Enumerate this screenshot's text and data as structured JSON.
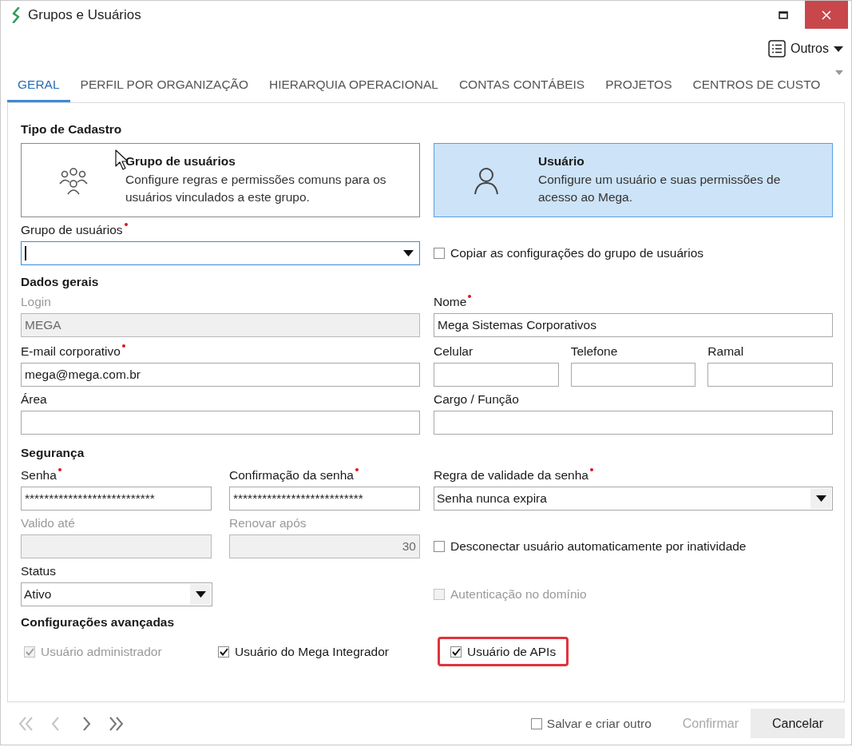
{
  "window": {
    "title": "Grupos e Usuários"
  },
  "toolbar": {
    "menu_label": "Outros"
  },
  "tabs": [
    {
      "label": "GERAL",
      "selected": true
    },
    {
      "label": "PERFIL POR ORGANIZAÇÃO",
      "selected": false
    },
    {
      "label": "HIERARQUIA OPERACIONAL",
      "selected": false
    },
    {
      "label": "CONTAS CONTÁBEIS",
      "selected": false
    },
    {
      "label": "PROJETOS",
      "selected": false
    },
    {
      "label": "CENTROS DE CUSTO",
      "selected": false
    }
  ],
  "registration_type": {
    "title": "Tipo de Cadastro",
    "options": [
      {
        "kind": "group",
        "title": "Grupo de usuários",
        "description": "Configure regras e permissões comuns para os usuários vinculados a este grupo.",
        "selected": false
      },
      {
        "kind": "user",
        "title": "Usuário",
        "description": "Configure um usuário e suas permissões de acesso ao Mega.",
        "selected": true
      }
    ]
  },
  "user_group": {
    "field": {
      "kind": "combo",
      "label": "Grupo de usuários",
      "required": true,
      "disabled": false,
      "focused": true
    },
    "copy_settings": {
      "label": "Copiar as configurações do grupo de usuários",
      "checked": false,
      "disabled": false
    }
  },
  "general_data": {
    "title": "Dados gerais",
    "login": {
      "kind": "text",
      "label": "Login",
      "value": "MEGA",
      "required": false,
      "disabled": true
    },
    "name": {
      "kind": "text",
      "label": "Nome",
      "value": "Mega Sistemas Corporativos",
      "required": true,
      "disabled": false
    },
    "email": {
      "kind": "text",
      "label": "E-mail corporativo",
      "value": "mega@mega.com.br",
      "required": true,
      "disabled": false
    },
    "mobile": {
      "kind": "text",
      "label": "Celular",
      "required": false,
      "disabled": false
    },
    "phone": {
      "kind": "text",
      "label": "Telefone",
      "required": false,
      "disabled": false
    },
    "extension": {
      "kind": "text",
      "label": "Ramal",
      "required": false,
      "disabled": false
    },
    "area": {
      "kind": "text",
      "label": "Área",
      "required": false,
      "disabled": false
    },
    "position": {
      "kind": "text",
      "label": "Cargo / Função",
      "required": false,
      "disabled": false
    }
  },
  "security": {
    "title": "Segurança",
    "password": {
      "kind": "text",
      "label": "Senha",
      "value": "***************************",
      "required": true,
      "disabled": false
    },
    "password_confirmation": {
      "kind": "text",
      "label": "Confirmação da senha",
      "value": "***************************",
      "required": true,
      "disabled": false
    },
    "password_rule": {
      "kind": "combo",
      "label": "Regra de validade da senha",
      "value": "Senha nunca expira",
      "required": true,
      "disabled": false
    },
    "valid_until": {
      "kind": "text",
      "label": "Valido até",
      "required": false,
      "disabled": true
    },
    "renew_after": {
      "kind": "number",
      "label": "Renovar após",
      "value": "30",
      "required": false,
      "disabled": true
    },
    "auto_disconnect": {
      "label": "Desconectar usuário automaticamente por inatividade",
      "checked": false,
      "disabled": false
    },
    "domain_auth": {
      "label": "Autenticação no domínio",
      "checked": false,
      "disabled": true
    },
    "status": {
      "kind": "combo",
      "label": "Status",
      "value": "Ativo",
      "required": false,
      "disabled": false
    }
  },
  "advanced": {
    "title": "Configurações avançadas",
    "options": [
      {
        "label": "Usuário administrador",
        "checked": true,
        "disabled": true,
        "highlighted": false
      },
      {
        "label": "Usuário do Mega Integrador",
        "checked": true,
        "disabled": false,
        "highlighted": false
      },
      {
        "label": "Usuário de APIs",
        "checked": true,
        "disabled": false,
        "highlighted": true
      }
    ]
  },
  "footer": {
    "navigation": [
      {
        "kind": "first",
        "disabled": true
      },
      {
        "kind": "previous",
        "disabled": true
      },
      {
        "kind": "next",
        "disabled": false
      },
      {
        "kind": "last",
        "disabled": false
      }
    ],
    "save_and_new": {
      "label": "Salvar e criar outro",
      "checked": false,
      "disabled": false
    },
    "buttons": [
      {
        "kind": "confirm",
        "label": "Confirmar",
        "disabled": true
      },
      {
        "kind": "cancel",
        "label": "Cancelar",
        "disabled": false
      }
    ]
  }
}
